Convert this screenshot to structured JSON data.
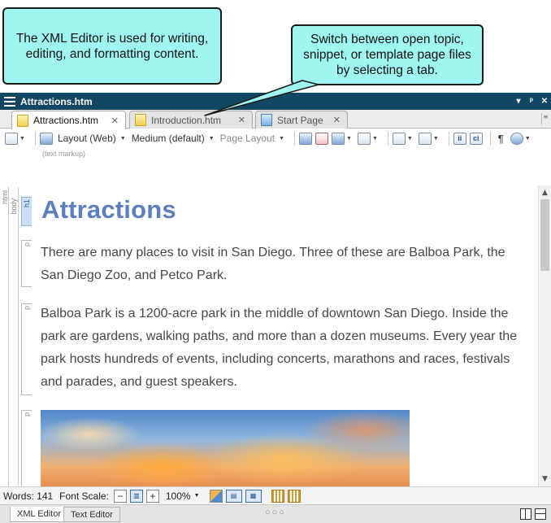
{
  "callouts": {
    "editor_note": "The XML Editor is used for writing, editing, and formatting content.",
    "tabs_note": "Switch between open topic, snippet, or template page files by selecting a tab."
  },
  "window": {
    "title": "Attractions.htm",
    "menu_glyph": "▾",
    "pin_glyph": "ᵖ",
    "close_glyph": "✕"
  },
  "tabs": [
    {
      "label": "Attractions.htm",
      "close": "✕",
      "icon": "topic-file-icon",
      "active": true
    },
    {
      "label": "Introduction.htm",
      "close": "✕",
      "icon": "topic-file-icon",
      "active": false
    },
    {
      "label": "Start Page",
      "close": "✕",
      "icon": "start-page-icon",
      "active": false
    }
  ],
  "toolbar": {
    "layout_label": "Layout (Web)",
    "medium_label": "Medium (default)",
    "page_layout_label": "Page Layout",
    "pilcrow": "¶",
    "markup_hint": "(text markup)"
  },
  "structure_bars": {
    "html": "html",
    "body": "body",
    "h1": "h1",
    "p": "p"
  },
  "document": {
    "heading": "Attractions",
    "paragraphs": [
      "There are many places to visit in San Diego. Three of these are Balboa Park, the San Diego Zoo, and Petco Park.",
      "Balboa Park is a 1200-acre park in the middle of downtown San Diego. Inside the park are gardens, walking paths, and more than a dozen museums. Every year the park hosts hundreds of events, including concerts, marathons and races, festivals and parades, and guest speakers."
    ],
    "image_icon": "sunset-sky-image"
  },
  "status": {
    "words_label": "Words:",
    "words_count": "141",
    "font_scale_label": "Font Scale:",
    "minus": "−",
    "plus": "+",
    "zoom": "100%"
  },
  "modes": {
    "xml_editor": "XML Editor",
    "text_editor": "Text Editor",
    "grip": "○○○"
  },
  "colors": {
    "titlebar": "#124763",
    "callout": "#9ff5ef",
    "heading": "#5b7fbf"
  }
}
